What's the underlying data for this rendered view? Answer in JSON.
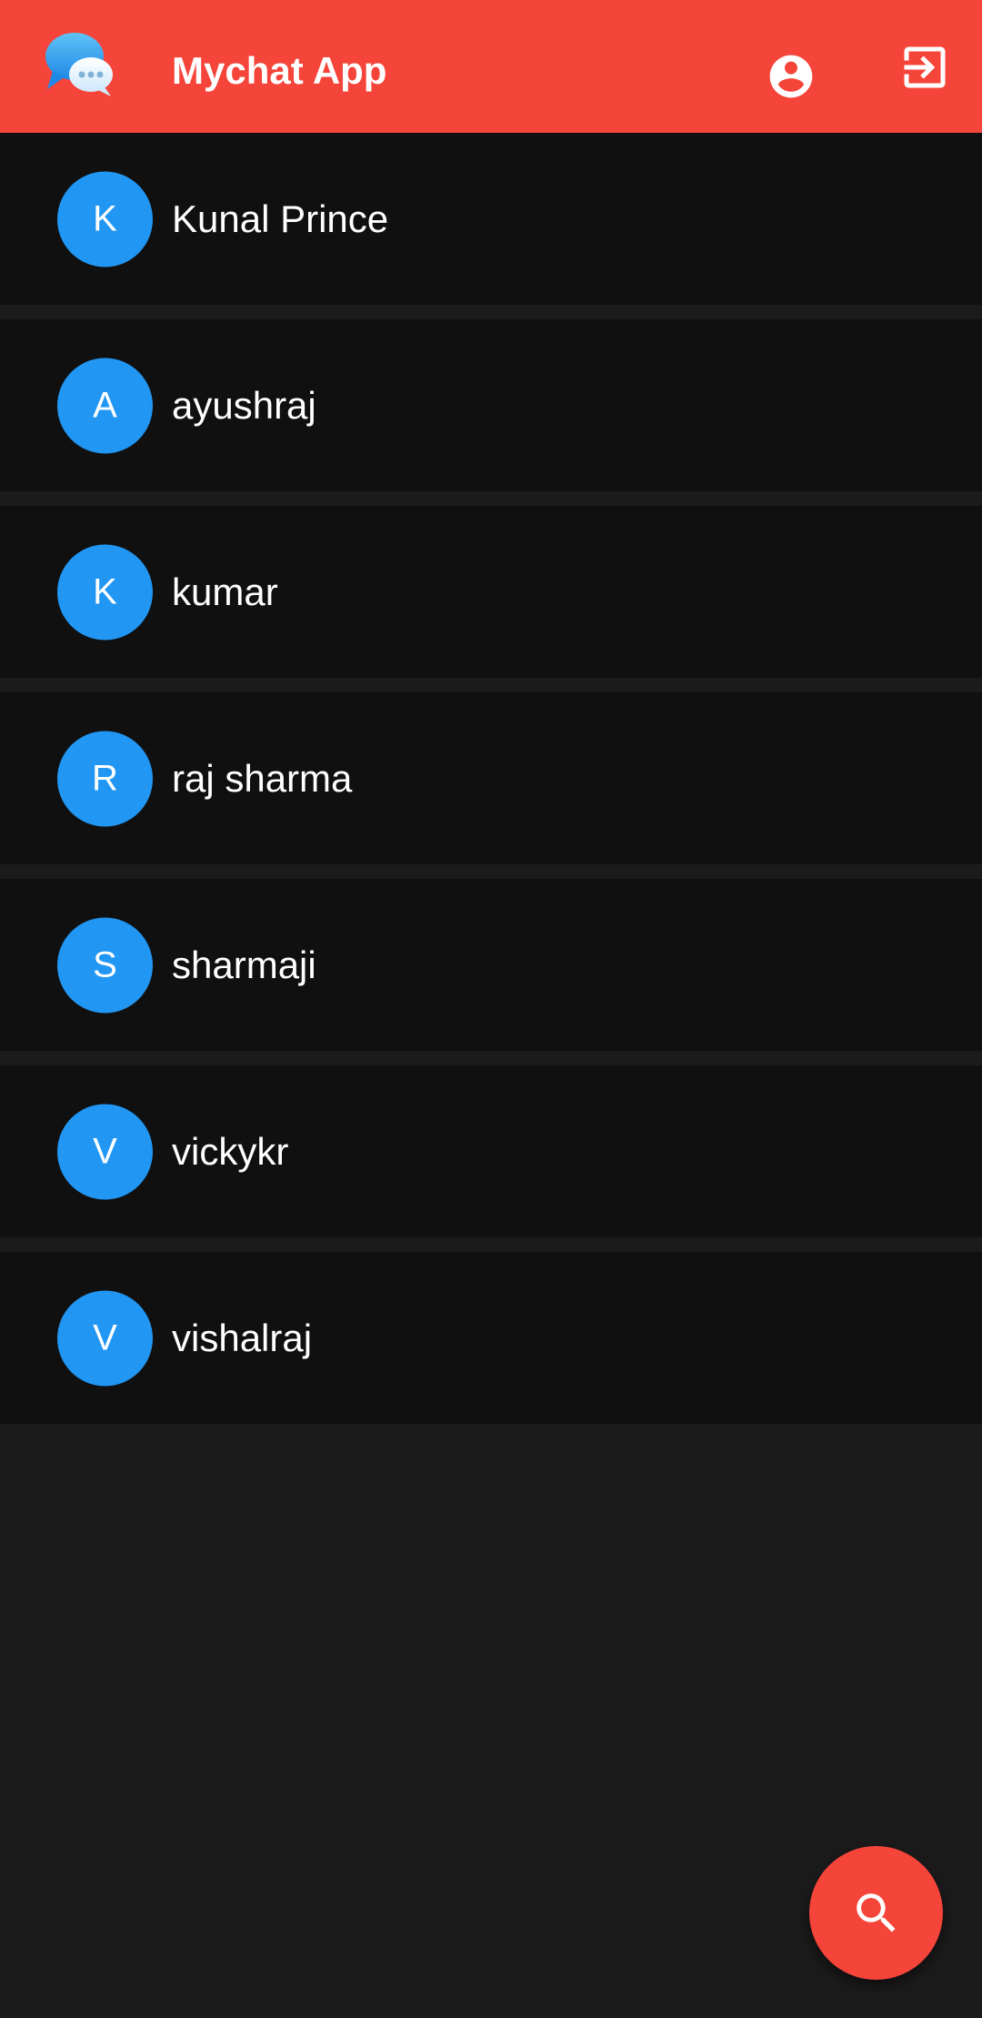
{
  "appbar": {
    "title": "Mychat App",
    "logo_icon": "chat-bubbles-icon",
    "profile_icon": "account-circle-icon",
    "logout_icon": "logout-icon",
    "color": "#f5443a"
  },
  "contacts": [
    {
      "initial": "K",
      "name": "Kunal Prince"
    },
    {
      "initial": "A",
      "name": "ayushraj"
    },
    {
      "initial": "K",
      "name": "kumar"
    },
    {
      "initial": "R",
      "name": "raj sharma"
    },
    {
      "initial": "S",
      "name": "sharmaji"
    },
    {
      "initial": "V",
      "name": "vickykr"
    },
    {
      "initial": "V",
      "name": "vishalraj"
    }
  ],
  "avatar_color": "#2196f3",
  "fab": {
    "icon": "search-icon",
    "color": "#f5443a"
  }
}
